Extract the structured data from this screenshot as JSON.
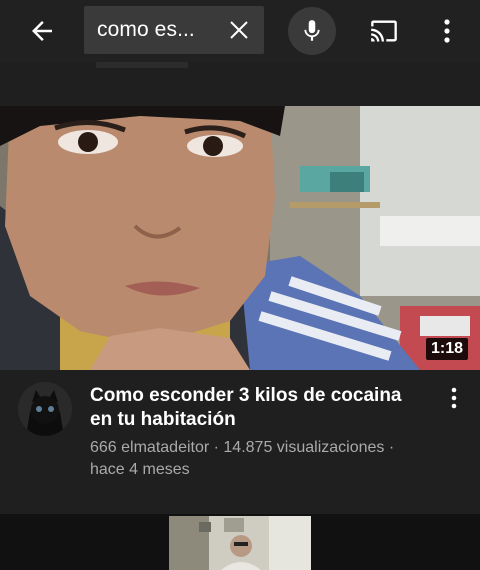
{
  "search": {
    "query": "como es..."
  },
  "video": {
    "title": "Como esconder 3 kilos de cocaina en tu habitación",
    "channel": "666 elmatadeitor",
    "separator": " · ",
    "views": "14.875 visualizaciones",
    "age": "hace 4 meses",
    "duration": "1:18"
  },
  "icons": {
    "back": "arrow-left-icon",
    "clear": "close-icon",
    "mic": "microphone-icon",
    "cast": "cast-icon",
    "more": "more-vertical-icon"
  },
  "colors": {
    "background": "#1f1f1f",
    "topbar": "#212121",
    "search_box": "#3a3a3a",
    "secondary_text": "#aaaaaa"
  }
}
